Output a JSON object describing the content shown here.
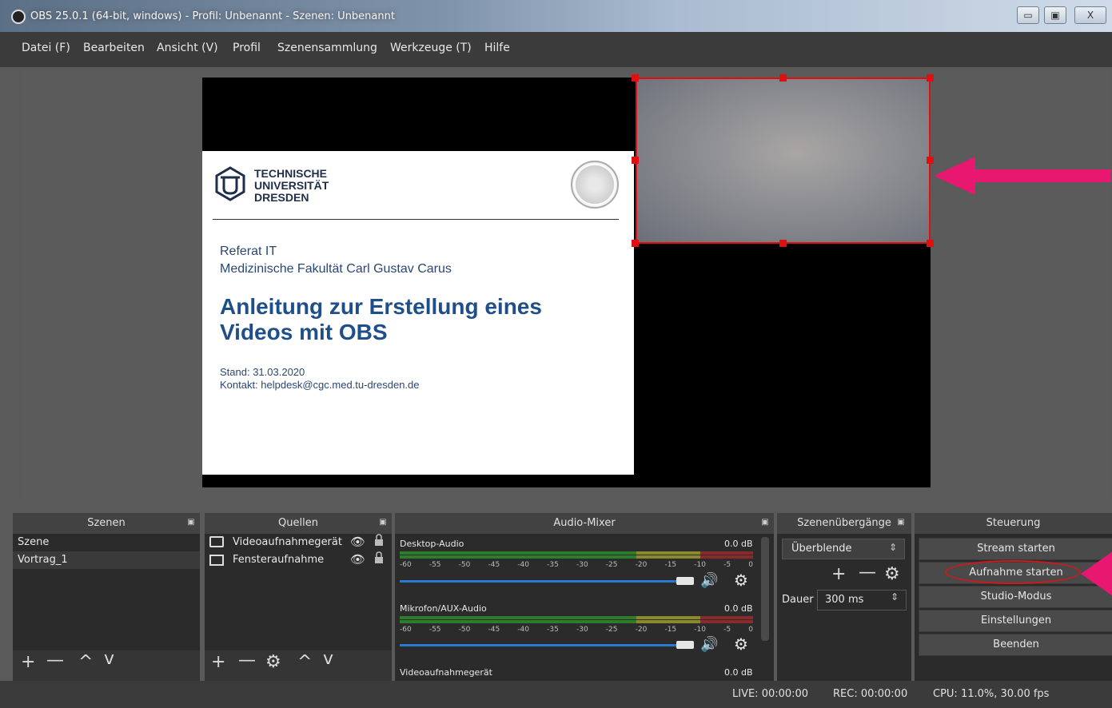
{
  "window": {
    "title": "OBS 25.0.1 (64-bit, windows) - Profil: Unbenannt - Szenen: Unbenannt",
    "minimize_label": "▭",
    "maximize_label": "▣",
    "close_label": "X"
  },
  "menu": [
    "Datei (F)",
    "Bearbeiten",
    "Ansicht (V)",
    "Profil",
    "Szenensammlung",
    "Werkzeuge (T)",
    "Hilfe"
  ],
  "slide": {
    "logo_lines": [
      "TECHNISCHE",
      "UNIVERSITÄT",
      "DRESDEN"
    ],
    "subtitle1": "Referat IT",
    "subtitle2": "Medizinische Fakultät Carl Gustav Carus",
    "title_line1": "Anleitung zur Erstellung eines",
    "title_line2": "Videos mit OBS",
    "stand": "Stand: 31.03.2020",
    "kontakt": "Kontakt: helpdesk@cgc.med.tu-dresden.de"
  },
  "docks": {
    "scenes": {
      "title": "Szenen",
      "items": [
        "Szene",
        "Vortrag_1"
      ]
    },
    "sources": {
      "title": "Quellen",
      "items": [
        "Videoaufnahmegerät",
        "Fensteraufnahme"
      ]
    },
    "audio": {
      "title": "Audio-Mixer",
      "channels": [
        {
          "name": "Desktop-Audio",
          "level": "0.0 dB"
        },
        {
          "name": "Mikrofon/AUX-Audio",
          "level": "0.0 dB"
        },
        {
          "name": "Videoaufnahmegerät",
          "level": "0.0 dB"
        }
      ],
      "ticks": [
        "-60",
        "-55",
        "-50",
        "-45",
        "-40",
        "-35",
        "-30",
        "-25",
        "-20",
        "-15",
        "-10",
        "-5",
        "0"
      ]
    },
    "transitions": {
      "title": "Szenenübergänge",
      "selected": "Überblende",
      "duration_label": "Dauer",
      "duration_value": "300 ms"
    },
    "controls": {
      "title": "Steuerung",
      "buttons": [
        "Stream starten",
        "Aufnahme starten",
        "Studio-Modus",
        "Einstellungen",
        "Beenden"
      ]
    }
  },
  "status": {
    "live": "LIVE: 00:00:00",
    "rec": "REC: 00:00:00",
    "cpu": "CPU: 11.0%, 30.00 fps"
  },
  "colors": {
    "highlight": "#e01010",
    "annotation_arrow": "#e8176f"
  }
}
